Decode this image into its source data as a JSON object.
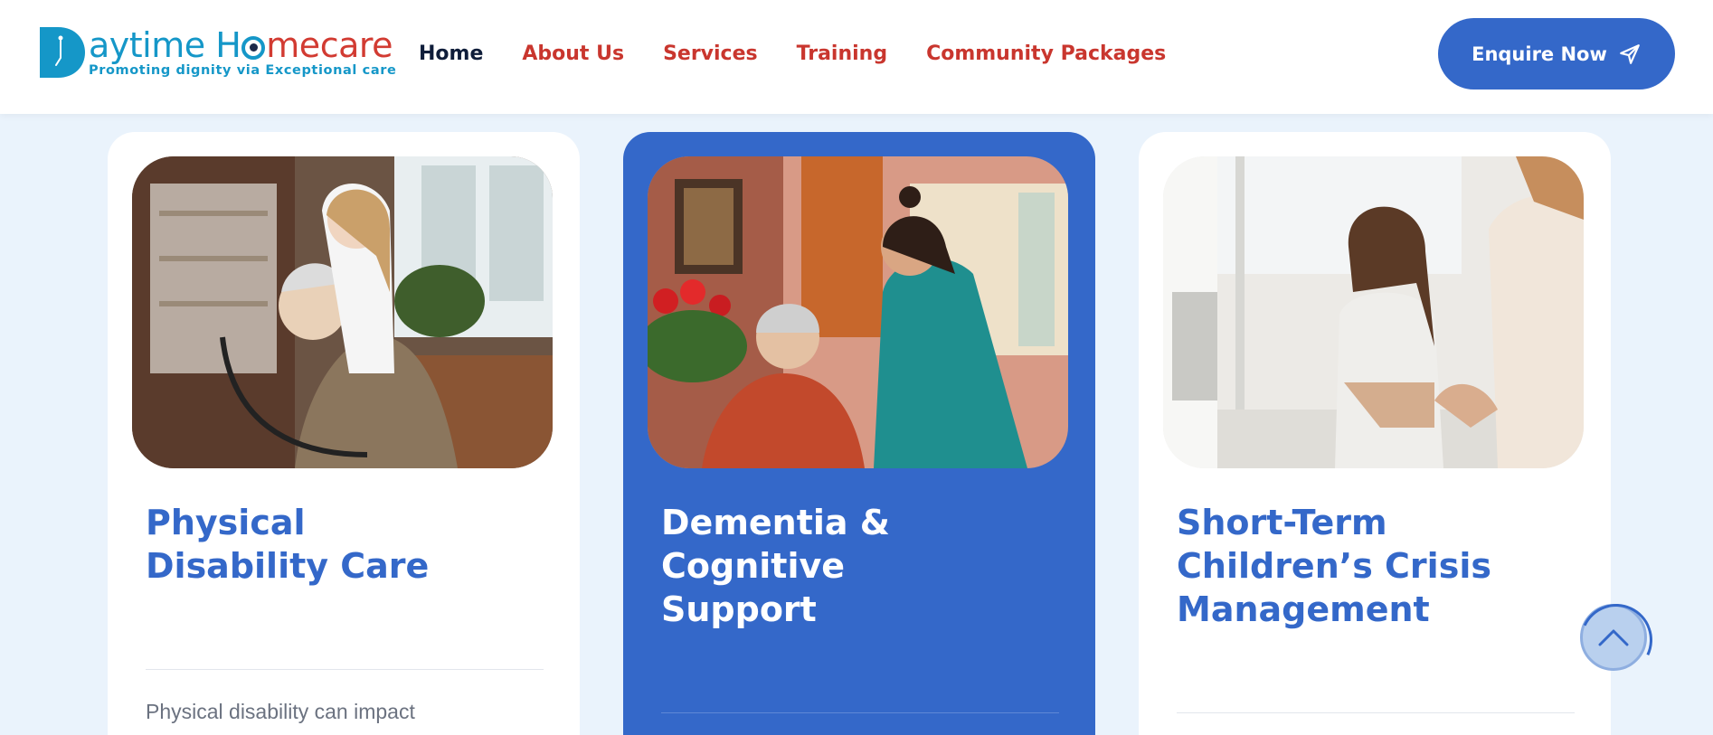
{
  "brand": {
    "title_part1": "aytime H",
    "title_part2": "me",
    "title_part3": "care",
    "tagline": "Promoting dignity via Exceptional care"
  },
  "nav": {
    "items": [
      {
        "label": "Home",
        "active": true
      },
      {
        "label": "About Us"
      },
      {
        "label": "Services"
      },
      {
        "label": "Training"
      },
      {
        "label": "Community Packages"
      }
    ]
  },
  "cta": {
    "label": "Enquire Now",
    "icon": "send-icon"
  },
  "cards": [
    {
      "title": "Physical\nDisability Care",
      "text": "Physical disability can impact",
      "image": "caregiver-with-elderly-man-in-wheelchair"
    },
    {
      "title": "Dementia &\nCognitive\nSupport",
      "text": "",
      "image": "nurse-with-elderly-woman"
    },
    {
      "title": "Short-Term\nChildren’s Crisis\nManagement",
      "text": "",
      "image": "counselling-session-woman"
    }
  ],
  "colors": {
    "accent": "#3468c9",
    "brand_blue": "#1597c8",
    "brand_red": "#d23b32",
    "page_bg": "#eaf3fc"
  },
  "scroll_top": {
    "icon": "chevron-up-icon"
  }
}
